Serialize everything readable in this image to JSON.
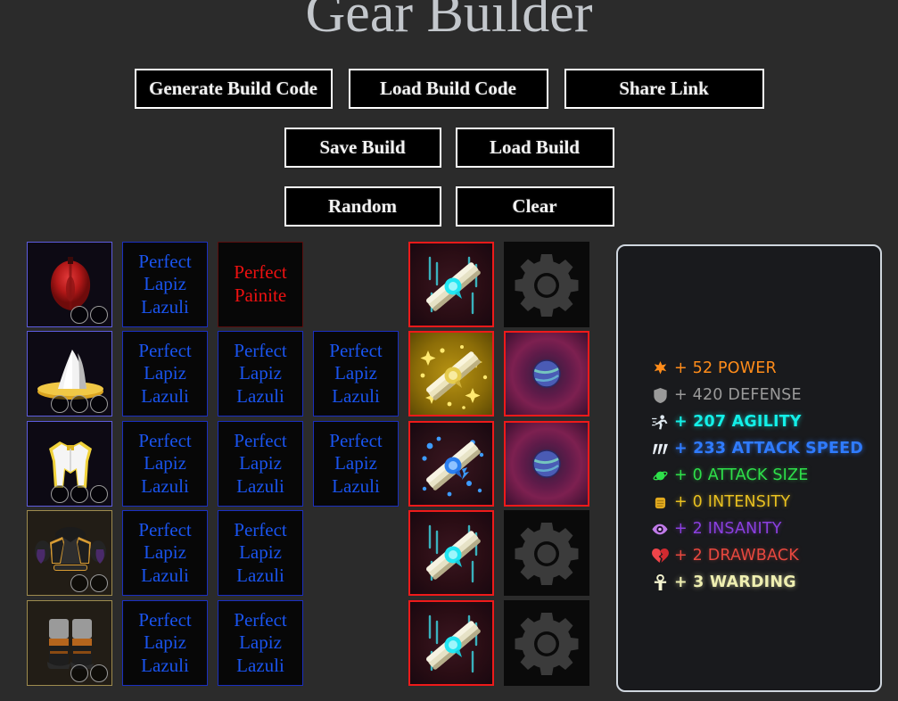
{
  "app": {
    "title": "Gear Builder",
    "background_color": "#2b2b2b"
  },
  "toolbar": {
    "row1": [
      {
        "label": "Generate Build Code",
        "name": "generate-build-code-button"
      },
      {
        "label": "Load Build Code",
        "name": "load-build-code-button"
      },
      {
        "label": "Share Link",
        "name": "share-link-button"
      }
    ],
    "row2": [
      {
        "label": "Save Build",
        "name": "save-build-button"
      },
      {
        "label": "Load Build",
        "name": "load-build-button"
      }
    ],
    "row3": [
      {
        "label": "Random",
        "name": "random-button"
      },
      {
        "label": "Clear",
        "name": "clear-button"
      }
    ]
  },
  "gear_rows": [
    {
      "item": {
        "icon": "red-helmet-icon",
        "gem_slots": 2,
        "border_color": "#5d5ce0"
      },
      "gems": [
        {
          "label": "Perfect Lapiz Lazuli",
          "color": "#1a54ef"
        },
        {
          "label": "Perfect Painite",
          "color": "#ee1111"
        }
      ],
      "enchant": {
        "icon": "cyan-scroll-icon",
        "border_color": "#ee1a1a"
      },
      "modifier": {
        "icon": "gear-icon",
        "empty": true
      }
    },
    {
      "item": {
        "icon": "wizard-hat-icon",
        "gem_slots": 3,
        "border_color": "#5d5ce0"
      },
      "gems": [
        {
          "label": "Perfect Lapiz Lazuli",
          "color": "#1a54ef"
        },
        {
          "label": "Perfect Lapiz Lazuli",
          "color": "#1a54ef"
        },
        {
          "label": "Perfect Lapiz Lazuli",
          "color": "#1a54ef"
        }
      ],
      "enchant": {
        "icon": "gold-scroll-icon",
        "border_color": "#ee1a1a"
      },
      "modifier": {
        "icon": "purple-orb-icon",
        "empty": false
      }
    },
    {
      "item": {
        "icon": "white-gold-robe-icon",
        "gem_slots": 3,
        "border_color": "#5d5ce0"
      },
      "gems": [
        {
          "label": "Perfect Lapiz Lazuli",
          "color": "#1a54ef"
        },
        {
          "label": "Perfect Lapiz Lazuli",
          "color": "#1a54ef"
        },
        {
          "label": "Perfect Lapiz Lazuli",
          "color": "#1a54ef"
        }
      ],
      "enchant": {
        "icon": "blue-scroll-icon",
        "border_color": "#ee1a1a"
      },
      "modifier": {
        "icon": "purple-orb-icon",
        "empty": false
      }
    },
    {
      "item": {
        "icon": "dark-chestplate-icon",
        "gem_slots": 2,
        "border_color": "#9e8b4e"
      },
      "gems": [
        {
          "label": "Perfect Lapiz Lazuli",
          "color": "#1a54ef"
        },
        {
          "label": "Perfect Lapiz Lazuli",
          "color": "#1a54ef"
        }
      ],
      "enchant": {
        "icon": "cyan-scroll-icon",
        "border_color": "#ee1a1a"
      },
      "modifier": {
        "icon": "gear-icon",
        "empty": true
      }
    },
    {
      "item": {
        "icon": "boots-icon",
        "gem_slots": 2,
        "border_color": "#9e8b4e"
      },
      "gems": [
        {
          "label": "Perfect Lapiz Lazuli",
          "color": "#1a54ef"
        },
        {
          "label": "Perfect Lapiz Lazuli",
          "color": "#1a54ef"
        }
      ],
      "enchant": {
        "icon": "cyan-scroll-icon",
        "border_color": "#ee1a1a"
      },
      "modifier": {
        "icon": "gear-icon",
        "empty": true
      }
    }
  ],
  "stats": [
    {
      "icon": "star-icon",
      "text": "+ 52 POWER",
      "value": 52,
      "name": "POWER",
      "color": "#ff8c1a"
    },
    {
      "icon": "shield-icon",
      "text": "+ 420 DEFENSE",
      "value": 420,
      "name": "DEFENSE",
      "color": "#9a9a9a"
    },
    {
      "icon": "runner-icon",
      "text": "+ 207 AGILITY",
      "value": 207,
      "name": "AGILITY",
      "color": "#13f0e8"
    },
    {
      "icon": "speed-lines-icon",
      "text": "+ 233 ATTACK SPEED",
      "value": 233,
      "name": "ATTACK SPEED",
      "color": "#2f7bff"
    },
    {
      "icon": "planet-icon",
      "text": "+ 0 ATTACK SIZE",
      "value": 0,
      "name": "ATTACK SIZE",
      "color": "#2ee04a"
    },
    {
      "icon": "fist-icon",
      "text": "+ 0 INTENSITY",
      "value": 0,
      "name": "INTENSITY",
      "color": "#e8c020"
    },
    {
      "icon": "eye-icon",
      "text": "+ 2 INSANITY",
      "value": 2,
      "name": "INSANITY",
      "color": "#8b3fe0"
    },
    {
      "icon": "broken-heart-icon",
      "text": "+ 2 DRAWBACK",
      "value": 2,
      "name": "DRAWBACK",
      "color": "#e8483f"
    },
    {
      "icon": "ankh-icon",
      "text": "+ 3 WARDING",
      "value": 3,
      "name": "WARDING",
      "color": "#eeeeb0"
    }
  ]
}
